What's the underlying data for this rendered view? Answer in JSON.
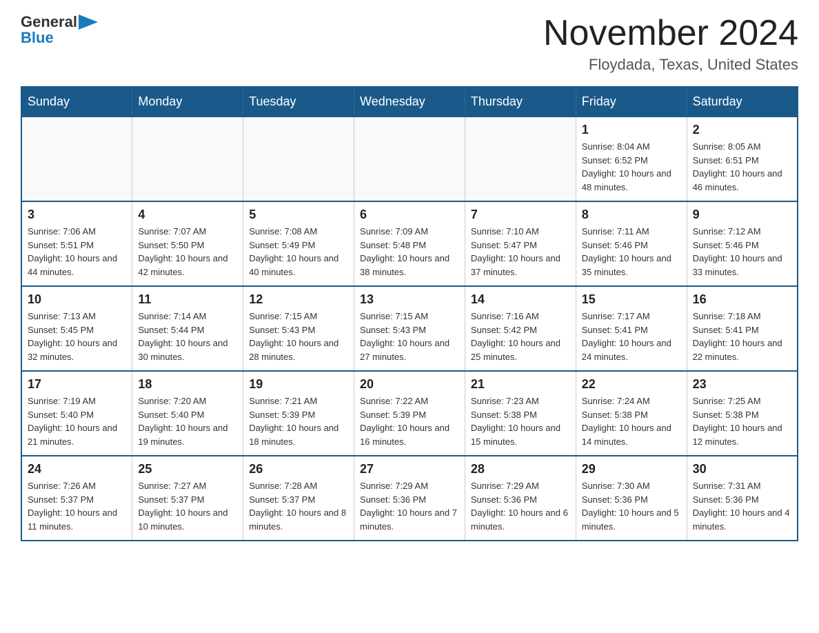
{
  "logo": {
    "general": "General",
    "blue": "Blue"
  },
  "title": "November 2024",
  "subtitle": "Floydada, Texas, United States",
  "weekdays": [
    "Sunday",
    "Monday",
    "Tuesday",
    "Wednesday",
    "Thursday",
    "Friday",
    "Saturday"
  ],
  "weeks": [
    [
      {
        "day": "",
        "info": ""
      },
      {
        "day": "",
        "info": ""
      },
      {
        "day": "",
        "info": ""
      },
      {
        "day": "",
        "info": ""
      },
      {
        "day": "",
        "info": ""
      },
      {
        "day": "1",
        "info": "Sunrise: 8:04 AM\nSunset: 6:52 PM\nDaylight: 10 hours and 48 minutes."
      },
      {
        "day": "2",
        "info": "Sunrise: 8:05 AM\nSunset: 6:51 PM\nDaylight: 10 hours and 46 minutes."
      }
    ],
    [
      {
        "day": "3",
        "info": "Sunrise: 7:06 AM\nSunset: 5:51 PM\nDaylight: 10 hours and 44 minutes."
      },
      {
        "day": "4",
        "info": "Sunrise: 7:07 AM\nSunset: 5:50 PM\nDaylight: 10 hours and 42 minutes."
      },
      {
        "day": "5",
        "info": "Sunrise: 7:08 AM\nSunset: 5:49 PM\nDaylight: 10 hours and 40 minutes."
      },
      {
        "day": "6",
        "info": "Sunrise: 7:09 AM\nSunset: 5:48 PM\nDaylight: 10 hours and 38 minutes."
      },
      {
        "day": "7",
        "info": "Sunrise: 7:10 AM\nSunset: 5:47 PM\nDaylight: 10 hours and 37 minutes."
      },
      {
        "day": "8",
        "info": "Sunrise: 7:11 AM\nSunset: 5:46 PM\nDaylight: 10 hours and 35 minutes."
      },
      {
        "day": "9",
        "info": "Sunrise: 7:12 AM\nSunset: 5:46 PM\nDaylight: 10 hours and 33 minutes."
      }
    ],
    [
      {
        "day": "10",
        "info": "Sunrise: 7:13 AM\nSunset: 5:45 PM\nDaylight: 10 hours and 32 minutes."
      },
      {
        "day": "11",
        "info": "Sunrise: 7:14 AM\nSunset: 5:44 PM\nDaylight: 10 hours and 30 minutes."
      },
      {
        "day": "12",
        "info": "Sunrise: 7:15 AM\nSunset: 5:43 PM\nDaylight: 10 hours and 28 minutes."
      },
      {
        "day": "13",
        "info": "Sunrise: 7:15 AM\nSunset: 5:43 PM\nDaylight: 10 hours and 27 minutes."
      },
      {
        "day": "14",
        "info": "Sunrise: 7:16 AM\nSunset: 5:42 PM\nDaylight: 10 hours and 25 minutes."
      },
      {
        "day": "15",
        "info": "Sunrise: 7:17 AM\nSunset: 5:41 PM\nDaylight: 10 hours and 24 minutes."
      },
      {
        "day": "16",
        "info": "Sunrise: 7:18 AM\nSunset: 5:41 PM\nDaylight: 10 hours and 22 minutes."
      }
    ],
    [
      {
        "day": "17",
        "info": "Sunrise: 7:19 AM\nSunset: 5:40 PM\nDaylight: 10 hours and 21 minutes."
      },
      {
        "day": "18",
        "info": "Sunrise: 7:20 AM\nSunset: 5:40 PM\nDaylight: 10 hours and 19 minutes."
      },
      {
        "day": "19",
        "info": "Sunrise: 7:21 AM\nSunset: 5:39 PM\nDaylight: 10 hours and 18 minutes."
      },
      {
        "day": "20",
        "info": "Sunrise: 7:22 AM\nSunset: 5:39 PM\nDaylight: 10 hours and 16 minutes."
      },
      {
        "day": "21",
        "info": "Sunrise: 7:23 AM\nSunset: 5:38 PM\nDaylight: 10 hours and 15 minutes."
      },
      {
        "day": "22",
        "info": "Sunrise: 7:24 AM\nSunset: 5:38 PM\nDaylight: 10 hours and 14 minutes."
      },
      {
        "day": "23",
        "info": "Sunrise: 7:25 AM\nSunset: 5:38 PM\nDaylight: 10 hours and 12 minutes."
      }
    ],
    [
      {
        "day": "24",
        "info": "Sunrise: 7:26 AM\nSunset: 5:37 PM\nDaylight: 10 hours and 11 minutes."
      },
      {
        "day": "25",
        "info": "Sunrise: 7:27 AM\nSunset: 5:37 PM\nDaylight: 10 hours and 10 minutes."
      },
      {
        "day": "26",
        "info": "Sunrise: 7:28 AM\nSunset: 5:37 PM\nDaylight: 10 hours and 8 minutes."
      },
      {
        "day": "27",
        "info": "Sunrise: 7:29 AM\nSunset: 5:36 PM\nDaylight: 10 hours and 7 minutes."
      },
      {
        "day": "28",
        "info": "Sunrise: 7:29 AM\nSunset: 5:36 PM\nDaylight: 10 hours and 6 minutes."
      },
      {
        "day": "29",
        "info": "Sunrise: 7:30 AM\nSunset: 5:36 PM\nDaylight: 10 hours and 5 minutes."
      },
      {
        "day": "30",
        "info": "Sunrise: 7:31 AM\nSunset: 5:36 PM\nDaylight: 10 hours and 4 minutes."
      }
    ]
  ]
}
